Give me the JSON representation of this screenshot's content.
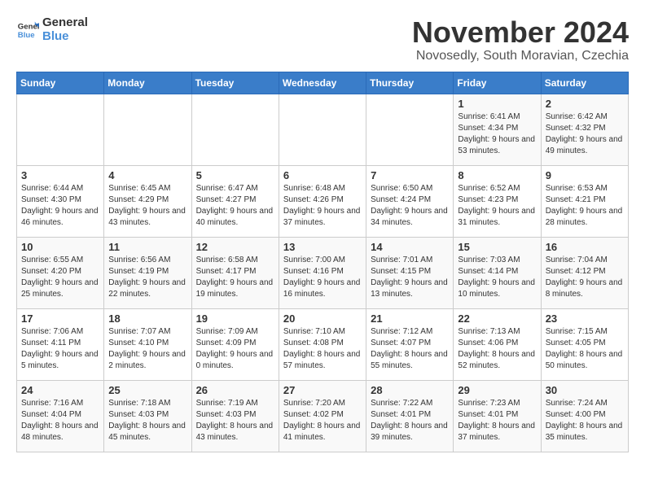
{
  "logo": {
    "general": "General",
    "blue": "Blue"
  },
  "title": "November 2024",
  "location": "Novosedly, South Moravian, Czechia",
  "days_of_week": [
    "Sunday",
    "Monday",
    "Tuesday",
    "Wednesday",
    "Thursday",
    "Friday",
    "Saturday"
  ],
  "weeks": [
    [
      {
        "day": "",
        "info": ""
      },
      {
        "day": "",
        "info": ""
      },
      {
        "day": "",
        "info": ""
      },
      {
        "day": "",
        "info": ""
      },
      {
        "day": "",
        "info": ""
      },
      {
        "day": "1",
        "info": "Sunrise: 6:41 AM\nSunset: 4:34 PM\nDaylight: 9 hours and 53 minutes."
      },
      {
        "day": "2",
        "info": "Sunrise: 6:42 AM\nSunset: 4:32 PM\nDaylight: 9 hours and 49 minutes."
      }
    ],
    [
      {
        "day": "3",
        "info": "Sunrise: 6:44 AM\nSunset: 4:30 PM\nDaylight: 9 hours and 46 minutes."
      },
      {
        "day": "4",
        "info": "Sunrise: 6:45 AM\nSunset: 4:29 PM\nDaylight: 9 hours and 43 minutes."
      },
      {
        "day": "5",
        "info": "Sunrise: 6:47 AM\nSunset: 4:27 PM\nDaylight: 9 hours and 40 minutes."
      },
      {
        "day": "6",
        "info": "Sunrise: 6:48 AM\nSunset: 4:26 PM\nDaylight: 9 hours and 37 minutes."
      },
      {
        "day": "7",
        "info": "Sunrise: 6:50 AM\nSunset: 4:24 PM\nDaylight: 9 hours and 34 minutes."
      },
      {
        "day": "8",
        "info": "Sunrise: 6:52 AM\nSunset: 4:23 PM\nDaylight: 9 hours and 31 minutes."
      },
      {
        "day": "9",
        "info": "Sunrise: 6:53 AM\nSunset: 4:21 PM\nDaylight: 9 hours and 28 minutes."
      }
    ],
    [
      {
        "day": "10",
        "info": "Sunrise: 6:55 AM\nSunset: 4:20 PM\nDaylight: 9 hours and 25 minutes."
      },
      {
        "day": "11",
        "info": "Sunrise: 6:56 AM\nSunset: 4:19 PM\nDaylight: 9 hours and 22 minutes."
      },
      {
        "day": "12",
        "info": "Sunrise: 6:58 AM\nSunset: 4:17 PM\nDaylight: 9 hours and 19 minutes."
      },
      {
        "day": "13",
        "info": "Sunrise: 7:00 AM\nSunset: 4:16 PM\nDaylight: 9 hours and 16 minutes."
      },
      {
        "day": "14",
        "info": "Sunrise: 7:01 AM\nSunset: 4:15 PM\nDaylight: 9 hours and 13 minutes."
      },
      {
        "day": "15",
        "info": "Sunrise: 7:03 AM\nSunset: 4:14 PM\nDaylight: 9 hours and 10 minutes."
      },
      {
        "day": "16",
        "info": "Sunrise: 7:04 AM\nSunset: 4:12 PM\nDaylight: 9 hours and 8 minutes."
      }
    ],
    [
      {
        "day": "17",
        "info": "Sunrise: 7:06 AM\nSunset: 4:11 PM\nDaylight: 9 hours and 5 minutes."
      },
      {
        "day": "18",
        "info": "Sunrise: 7:07 AM\nSunset: 4:10 PM\nDaylight: 9 hours and 2 minutes."
      },
      {
        "day": "19",
        "info": "Sunrise: 7:09 AM\nSunset: 4:09 PM\nDaylight: 9 hours and 0 minutes."
      },
      {
        "day": "20",
        "info": "Sunrise: 7:10 AM\nSunset: 4:08 PM\nDaylight: 8 hours and 57 minutes."
      },
      {
        "day": "21",
        "info": "Sunrise: 7:12 AM\nSunset: 4:07 PM\nDaylight: 8 hours and 55 minutes."
      },
      {
        "day": "22",
        "info": "Sunrise: 7:13 AM\nSunset: 4:06 PM\nDaylight: 8 hours and 52 minutes."
      },
      {
        "day": "23",
        "info": "Sunrise: 7:15 AM\nSunset: 4:05 PM\nDaylight: 8 hours and 50 minutes."
      }
    ],
    [
      {
        "day": "24",
        "info": "Sunrise: 7:16 AM\nSunset: 4:04 PM\nDaylight: 8 hours and 48 minutes."
      },
      {
        "day": "25",
        "info": "Sunrise: 7:18 AM\nSunset: 4:03 PM\nDaylight: 8 hours and 45 minutes."
      },
      {
        "day": "26",
        "info": "Sunrise: 7:19 AM\nSunset: 4:03 PM\nDaylight: 8 hours and 43 minutes."
      },
      {
        "day": "27",
        "info": "Sunrise: 7:20 AM\nSunset: 4:02 PM\nDaylight: 8 hours and 41 minutes."
      },
      {
        "day": "28",
        "info": "Sunrise: 7:22 AM\nSunset: 4:01 PM\nDaylight: 8 hours and 39 minutes."
      },
      {
        "day": "29",
        "info": "Sunrise: 7:23 AM\nSunset: 4:01 PM\nDaylight: 8 hours and 37 minutes."
      },
      {
        "day": "30",
        "info": "Sunrise: 7:24 AM\nSunset: 4:00 PM\nDaylight: 8 hours and 35 minutes."
      }
    ]
  ]
}
